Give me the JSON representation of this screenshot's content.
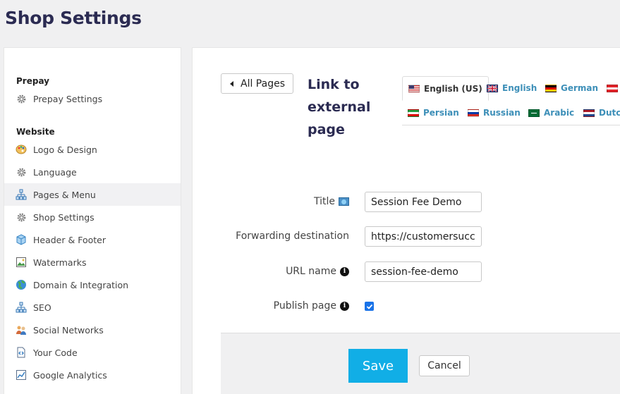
{
  "page_title": "Shop Settings",
  "sidebar": {
    "sections": [
      {
        "heading": "Prepay",
        "items": [
          {
            "label": "Prepay Settings",
            "icon": "gear-icon"
          }
        ]
      },
      {
        "heading": "Website",
        "items": [
          {
            "label": "Logo & Design",
            "icon": "palette-icon"
          },
          {
            "label": "Language",
            "icon": "gear-icon"
          },
          {
            "label": "Pages & Menu",
            "icon": "sitemap-icon",
            "active": true
          },
          {
            "label": "Shop Settings",
            "icon": "gear-icon"
          },
          {
            "label": "Header & Footer",
            "icon": "cube-icon"
          },
          {
            "label": "Watermarks",
            "icon": "image-icon"
          },
          {
            "label": "Domain & Integration",
            "icon": "globe-icon"
          },
          {
            "label": "SEO",
            "icon": "sitemap-icon"
          },
          {
            "label": "Social Networks",
            "icon": "users-icon"
          },
          {
            "label": "Your Code",
            "icon": "code-file-icon"
          },
          {
            "label": "Google Analytics",
            "icon": "analytics-icon"
          }
        ]
      }
    ]
  },
  "main": {
    "back_button": "All Pages",
    "section_title": "Link to external page",
    "languages": [
      {
        "label": "English (US)",
        "flag": "us",
        "active": true
      },
      {
        "label": "English",
        "flag": "uk"
      },
      {
        "label": "German",
        "flag": "de"
      },
      {
        "label": "",
        "flag": "at"
      },
      {
        "label": "Persian",
        "flag": "ir"
      },
      {
        "label": "Russian",
        "flag": "ru"
      },
      {
        "label": "Arabic",
        "flag": "sa"
      },
      {
        "label": "Dutch",
        "flag": "nl"
      }
    ],
    "form": {
      "title_label": "Title",
      "title_value": "Session Fee Demo",
      "forwarding_label": "Forwarding destination",
      "forwarding_value": "https://customersuccess",
      "url_label": "URL name",
      "url_value": "session-fee-demo",
      "publish_label": "Publish page",
      "publish_checked": true
    },
    "save_label": "Save",
    "cancel_label": "Cancel"
  },
  "colors": {
    "accent": "#11aee6",
    "link": "#3d8fb8",
    "title": "#2b2b52"
  }
}
